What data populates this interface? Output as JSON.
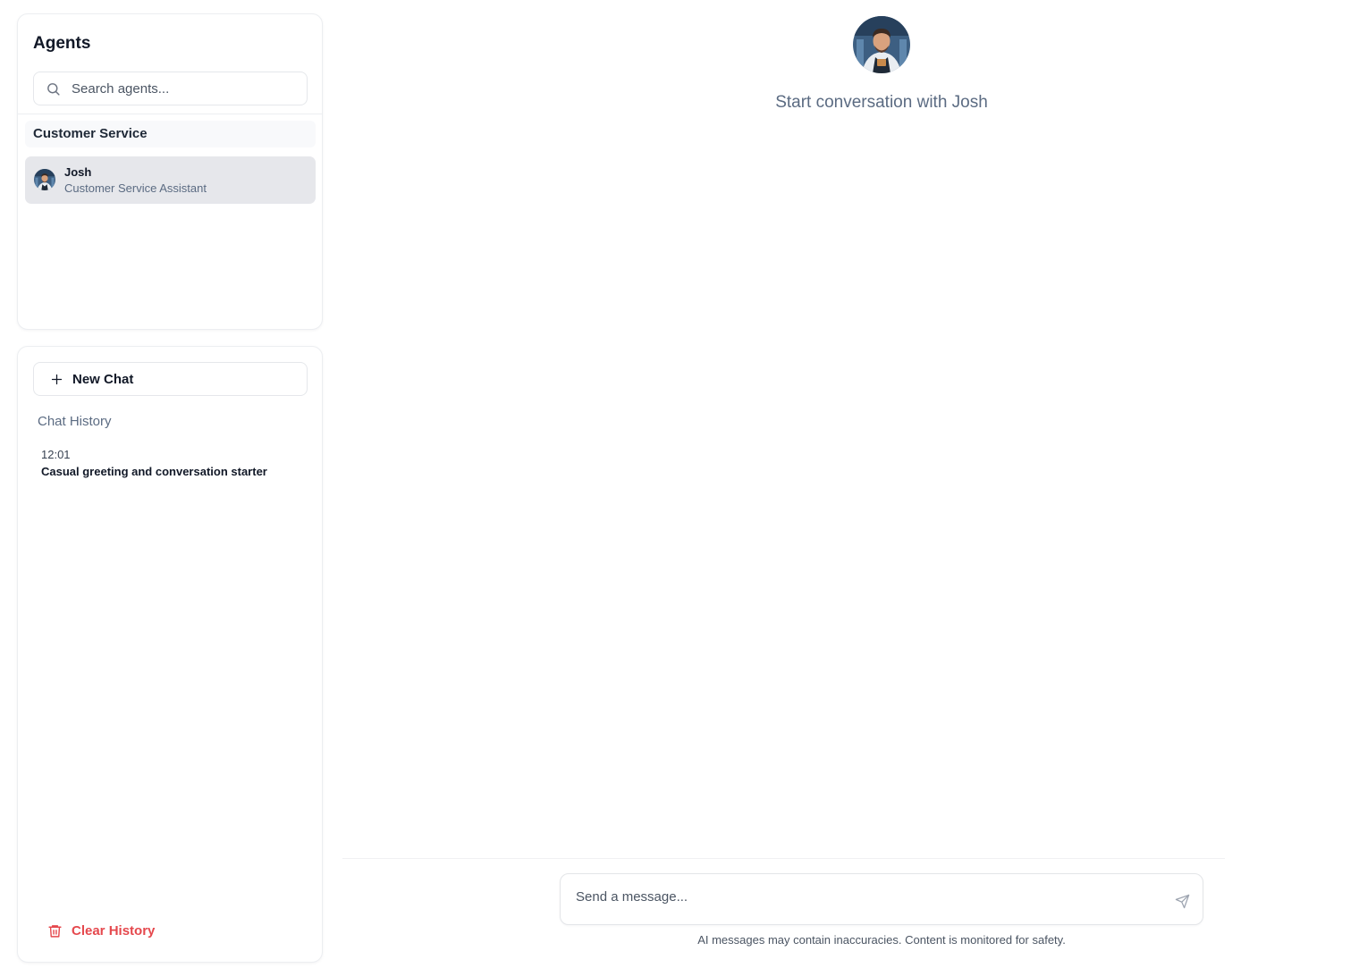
{
  "sidebar": {
    "agents_title": "Agents",
    "search": {
      "placeholder": "Search agents...",
      "value": ""
    },
    "groups": [
      {
        "name": "Customer Service",
        "agents": [
          {
            "name": "Josh",
            "role": "Customer Service Assistant",
            "selected": true
          }
        ]
      }
    ]
  },
  "history": {
    "new_chat_label": "New Chat",
    "title": "Chat History",
    "items": [
      {
        "time": "12:01",
        "title": "Casual greeting and conversation starter"
      }
    ],
    "clear_label": "Clear History"
  },
  "main": {
    "title": "Start conversation with Josh",
    "composer": {
      "placeholder": "Send a message...",
      "value": ""
    },
    "disclaimer": "AI messages may contain inaccuracies. Content is monitored for safety."
  },
  "colors": {
    "accent_red": "#e5484d",
    "muted_text": "#5b6b82",
    "selected_bg": "#e6e7eb"
  },
  "icons": [
    "search-icon",
    "plus-icon",
    "trash-icon",
    "send-icon",
    "avatar"
  ]
}
